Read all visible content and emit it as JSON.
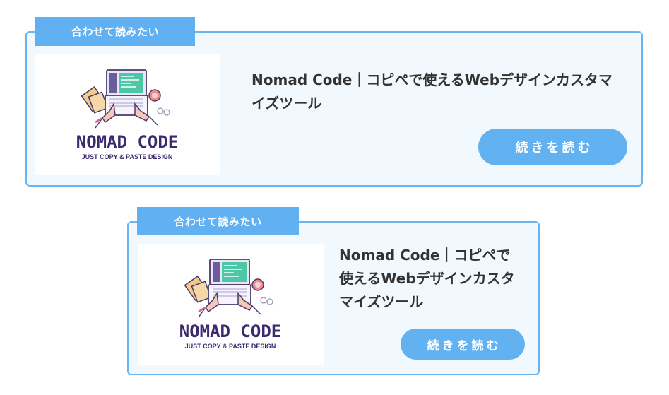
{
  "colors": {
    "border": "#6ab4ef",
    "tag_bg": "#60b0f2",
    "button_bg": "#62b1f1",
    "card_bg": "#f1f9fe",
    "title": "#333333"
  },
  "cards": [
    {
      "tag": "合わせて読みたい",
      "title": "Nomad Code｜コピペで使えるWebデザインカスタマイズツール",
      "logo_main": "NOMAD CODE",
      "logo_sub": "JUST COPY & PASTE DESIGN",
      "button": "続きを読む"
    },
    {
      "tag": "合わせて読みたい",
      "title": "Nomad Code｜コピペで使えるWebデザインカスタマイズツール",
      "logo_main": "NOMAD CODE",
      "logo_sub": "JUST COPY & PASTE DESIGN",
      "button": "続きを読む"
    }
  ]
}
